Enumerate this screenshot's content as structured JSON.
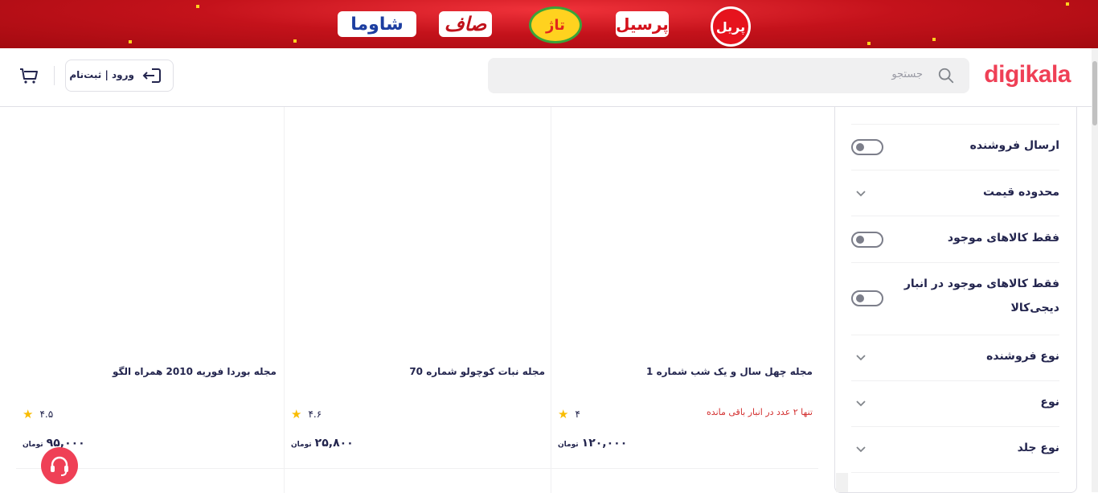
{
  "banner": {
    "brands": [
      "شاوما",
      "صاف",
      "تاژ",
      "پرسیل",
      "پریل"
    ]
  },
  "header": {
    "logo": "digikala",
    "search_placeholder": "جستجو",
    "login_label": "ورود | ثبت‌نام"
  },
  "products": [
    {
      "title": "مجله چهل سال و یک شب شماره 1",
      "stock_note": "تنها ۲ عدد در انبار باقی مانده",
      "rating": "۴",
      "price": "۱۲۰,۰۰۰",
      "currency": "تومان"
    },
    {
      "title": "مجله نبات کوچولو شماره 70",
      "stock_note": "",
      "rating": "۴.۶",
      "price": "۲۵,۸۰۰",
      "currency": "تومان"
    },
    {
      "title": "مجله بوردا فوریه 2010 همراه الگو",
      "stock_note": "",
      "rating": "۴.۵",
      "price": "۹۵,۰۰۰",
      "currency": "تومان"
    }
  ],
  "filters": {
    "seller_shipping": "ارسال فروشنده",
    "price_range": "محدوده قیمت",
    "available_only": "فقط کالاهای موجود",
    "digikala_stock_line1": "فقط کالاهای موجود در انبار",
    "digikala_stock_line2": "دیجی‌کالا",
    "seller_type": "نوع فروشنده",
    "type": "نوع",
    "cover_type": "نوع جلد"
  },
  "colors": {
    "brand": "#ef4056",
    "star": "#f9bc00",
    "warning": "#d32f2f"
  }
}
